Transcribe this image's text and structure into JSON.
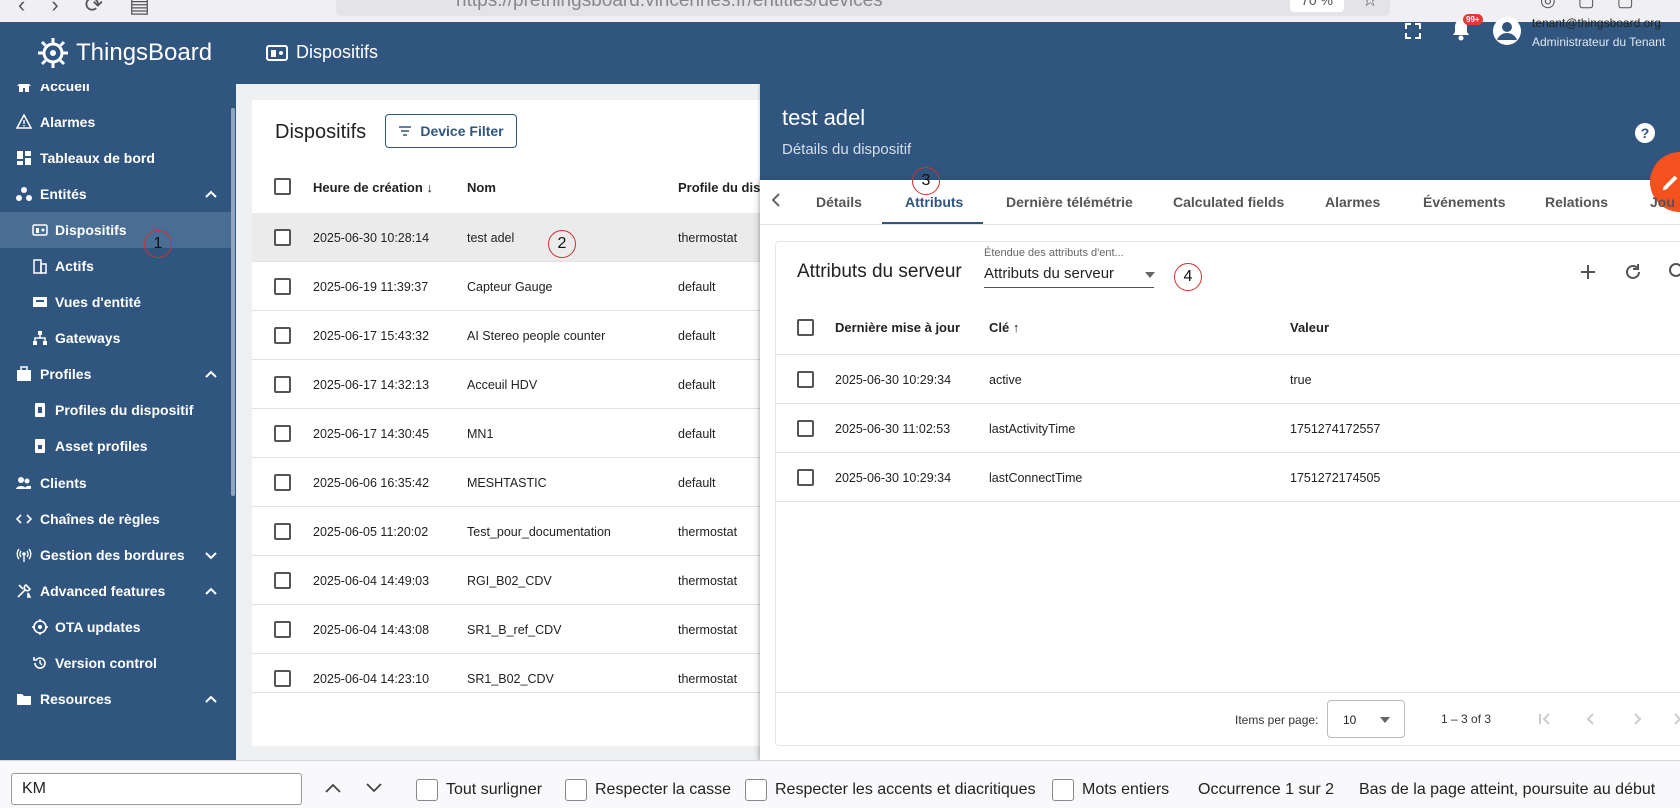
{
  "browser": {
    "url": "https://prethingsboard.vincennes.fr/entities/devices",
    "zoom": "70 %"
  },
  "topbar": {
    "logo": "ThingsBoard",
    "page_title": "Dispositifs",
    "notifications_badge": "99+",
    "user_email": "tenant@thingsboard.org",
    "user_role": "Administrateur du Tenant"
  },
  "sidebar": {
    "items": [
      {
        "label": "Accueil",
        "icon": "home-icon"
      },
      {
        "label": "Alarmes",
        "icon": "warning-icon"
      },
      {
        "label": "Tableaux de bord",
        "icon": "dashboard-icon"
      },
      {
        "label": "Entités",
        "icon": "entities-icon"
      },
      {
        "label": "Dispositifs",
        "icon": "devices-icon"
      },
      {
        "label": "Actifs",
        "icon": "assets-icon"
      },
      {
        "label": "Vues d'entité",
        "icon": "entity-view-icon"
      },
      {
        "label": "Gateways",
        "icon": "gateway-icon"
      },
      {
        "label": "Profiles",
        "icon": "profiles-icon"
      },
      {
        "label": "Profiles du dispositif",
        "icon": "device-profile-icon"
      },
      {
        "label": "Asset profiles",
        "icon": "asset-profile-icon"
      },
      {
        "label": "Clients",
        "icon": "clients-icon"
      },
      {
        "label": "Chaînes de règles",
        "icon": "code-icon"
      },
      {
        "label": "Gestion des bordures",
        "icon": "edge-icon"
      },
      {
        "label": "Advanced features",
        "icon": "tools-icon"
      },
      {
        "label": "OTA updates",
        "icon": "ota-icon"
      },
      {
        "label": "Version control",
        "icon": "history-icon"
      },
      {
        "label": "Resources",
        "icon": "folder-icon"
      }
    ]
  },
  "device_list": {
    "title": "Dispositifs",
    "filter_label": "Device Filter",
    "columns": [
      "Heure de création",
      "Nom",
      "Profile du disp"
    ],
    "rows": [
      {
        "created": "2025-06-30 10:28:14",
        "name": "test adel",
        "profile": "thermostat"
      },
      {
        "created": "2025-06-19 11:39:37",
        "name": "Capteur Gauge",
        "profile": "default"
      },
      {
        "created": "2025-06-17 15:43:32",
        "name": "AI Stereo people counter",
        "profile": "default"
      },
      {
        "created": "2025-06-17 14:32:13",
        "name": "Acceuil HDV",
        "profile": "default"
      },
      {
        "created": "2025-06-17 14:30:45",
        "name": "MN1",
        "profile": "default"
      },
      {
        "created": "2025-06-06 16:35:42",
        "name": "MESHTASTIC",
        "profile": "default"
      },
      {
        "created": "2025-06-05 11:20:02",
        "name": "Test_pour_documentation",
        "profile": "thermostat"
      },
      {
        "created": "2025-06-04 14:49:03",
        "name": "RGI_B02_CDV",
        "profile": "thermostat"
      },
      {
        "created": "2025-06-04 14:43:08",
        "name": "SR1_B_ref_CDV",
        "profile": "thermostat"
      },
      {
        "created": "2025-06-04 14:23:10",
        "name": "SR1_B02_CDV",
        "profile": "thermostat"
      }
    ]
  },
  "details": {
    "title": "test adel",
    "subtitle": "Détails du dispositif",
    "tabs": [
      "Détails",
      "Attributs",
      "Dernière télémétrie",
      "Calculated fields",
      "Alarmes",
      "Événements",
      "Relations",
      "Jou"
    ],
    "active_tab": "Attributs",
    "attributes": {
      "title": "Attributs du serveur",
      "scope_label": "Étendue des attributs d'ent...",
      "scope_value": "Attributs du serveur",
      "columns": [
        "Dernière mise à jour",
        "Clé",
        "Valeur"
      ],
      "rows": [
        {
          "updated": "2025-06-30 10:29:34",
          "key": "active",
          "value": "true"
        },
        {
          "updated": "2025-06-30 11:02:53",
          "key": "lastActivityTime",
          "value": "1751274172557"
        },
        {
          "updated": "2025-06-30 10:29:34",
          "key": "lastConnectTime",
          "value": "1751272174505"
        }
      ],
      "items_per_page_label": "Items per page:",
      "items_per_page": "10",
      "range": "1 – 3 of 3"
    }
  },
  "annotations": [
    "1",
    "2",
    "3",
    "4"
  ],
  "findbar": {
    "query": "KM",
    "options": [
      "Tout surligner",
      "Respecter la casse",
      "Respecter les accents et diacritiques",
      "Mots entiers"
    ],
    "occurrence": "Occurrence 1 sur 2",
    "status": "Bas de la page atteint, poursuite au début"
  },
  "colors": {
    "primary": "#305680",
    "active_item": "#4a6d94",
    "fab": "#f4511e",
    "annotation": "#d32f2f"
  }
}
